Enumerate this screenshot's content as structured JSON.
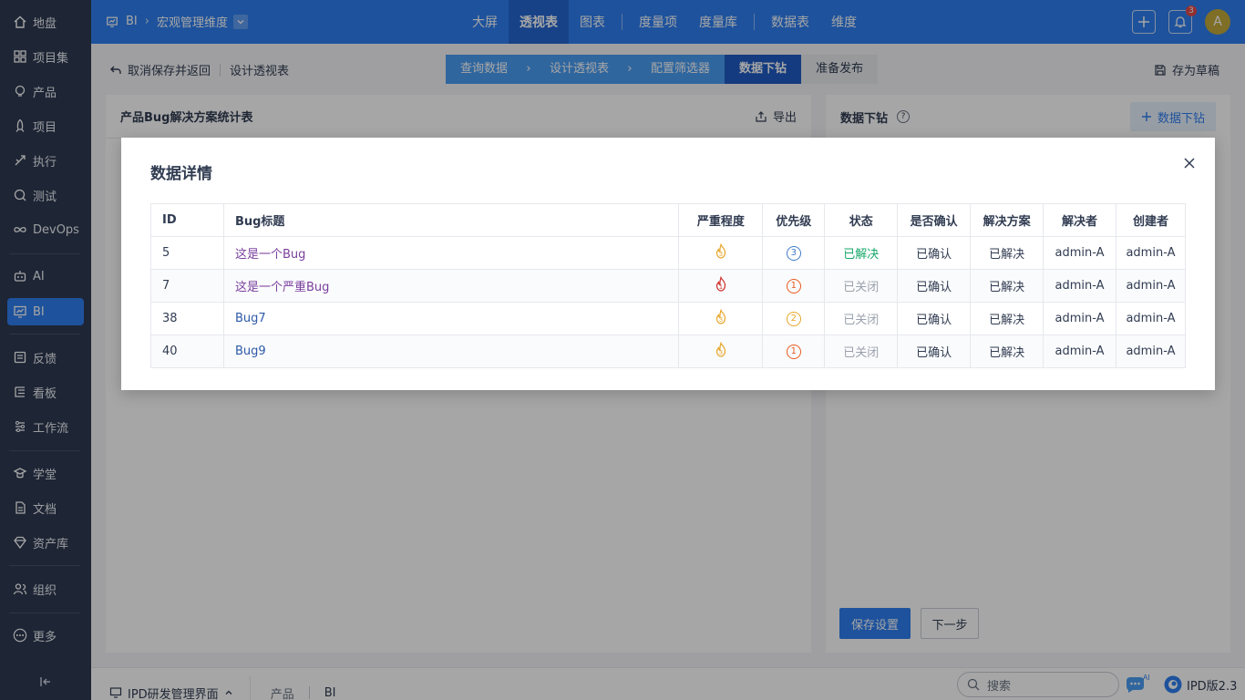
{
  "sidebar": {
    "items": [
      {
        "label": "地盘",
        "name": "sidebar-item-dashboard",
        "icon": "home-icon"
      },
      {
        "label": "项目集",
        "name": "sidebar-item-program",
        "icon": "grid-icon"
      },
      {
        "label": "产品",
        "name": "sidebar-item-product",
        "icon": "bulb-icon"
      },
      {
        "label": "项目",
        "name": "sidebar-item-project",
        "icon": "rocket-icon"
      },
      {
        "label": "执行",
        "name": "sidebar-item-execution",
        "icon": "run-icon"
      },
      {
        "label": "测试",
        "name": "sidebar-item-test",
        "icon": "test-icon"
      },
      {
        "label": "DevOps",
        "name": "sidebar-item-devops",
        "icon": "infinity-icon"
      },
      {
        "label": "AI",
        "name": "sidebar-item-ai",
        "icon": "robot-icon"
      },
      {
        "label": "BI",
        "name": "sidebar-item-bi",
        "icon": "chart-board-icon",
        "active": true
      },
      {
        "label": "反馈",
        "name": "sidebar-item-feedback",
        "icon": "feedback-icon"
      },
      {
        "label": "看板",
        "name": "sidebar-item-kanban",
        "icon": "kanban-icon"
      },
      {
        "label": "工作流",
        "name": "sidebar-item-workflow",
        "icon": "workflow-icon"
      },
      {
        "label": "学堂",
        "name": "sidebar-item-school",
        "icon": "school-icon"
      },
      {
        "label": "文档",
        "name": "sidebar-item-doc",
        "icon": "doc-icon"
      },
      {
        "label": "资产库",
        "name": "sidebar-item-asset",
        "icon": "diamond-icon"
      },
      {
        "label": "组织",
        "name": "sidebar-item-org",
        "icon": "people-icon"
      },
      {
        "label": "更多",
        "name": "sidebar-item-more",
        "icon": "more-icon"
      }
    ]
  },
  "header": {
    "module": "BI",
    "dimension": "宏观管理维度",
    "nav": [
      "大屏",
      "透视表",
      "图表",
      "度量项",
      "度量库",
      "数据表",
      "维度"
    ],
    "nav_active": "透视表",
    "notifications": "3",
    "avatar": "A"
  },
  "toolbar": {
    "cancel_label": "取消保存并返回",
    "design_label": "设计透视表",
    "steps": [
      "查询数据",
      "设计透视表",
      "配置筛选器",
      "数据下钻",
      "准备发布"
    ],
    "save_draft_label": "存为草稿"
  },
  "left_panel": {
    "title": "产品Bug解决方案统计表",
    "export_label": "导出"
  },
  "right_panel": {
    "title": "数据下钻",
    "add_label": "数据下钻",
    "save_label": "保存设置",
    "next_label": "下一步"
  },
  "bottom": {
    "app_label": "IPD研发管理界面",
    "crumb1": "产品",
    "crumb2": "BI",
    "search_placeholder": "搜索",
    "version": "IPD版2.3",
    "ai_tag": "AI"
  },
  "modal": {
    "title": "数据详情",
    "columns": [
      "ID",
      "Bug标题",
      "严重程度",
      "优先级",
      "状态",
      "是否确认",
      "解决方案",
      "解决者",
      "创建者"
    ],
    "rows": [
      {
        "id": "5",
        "title": "这是一个Bug",
        "severity": "3",
        "priority": "3",
        "status": "已解决",
        "confirmed": "已确认",
        "resolution": "已解决",
        "resolver": "admin-A",
        "creator": "admin-A"
      },
      {
        "id": "7",
        "title": "这是一个严重Bug",
        "severity": "1",
        "priority": "1",
        "status": "已关闭",
        "confirmed": "已确认",
        "resolution": "已解决",
        "resolver": "admin-A",
        "creator": "admin-A"
      },
      {
        "id": "38",
        "title": "Bug7",
        "severity": "3",
        "priority": "2",
        "status": "已关闭",
        "confirmed": "已确认",
        "resolution": "已解决",
        "resolver": "admin-A",
        "creator": "admin-A"
      },
      {
        "id": "40",
        "title": "Bug9",
        "severity": "3",
        "priority": "1",
        "status": "已关闭",
        "confirmed": "已确认",
        "resolution": "已解决",
        "resolver": "admin-A",
        "creator": "admin-A"
      }
    ]
  },
  "colors": {
    "brand": "#2e7ff0",
    "sidebar": "#2e3a52",
    "resolved": "#17a86a",
    "closed": "#9aa1ad",
    "severity_critical": "#d0322e",
    "severity_normal": "#e8a62a",
    "priority_1": "#e85a1f",
    "priority_2": "#e8a62a",
    "priority_3": "#3f7dc8"
  }
}
